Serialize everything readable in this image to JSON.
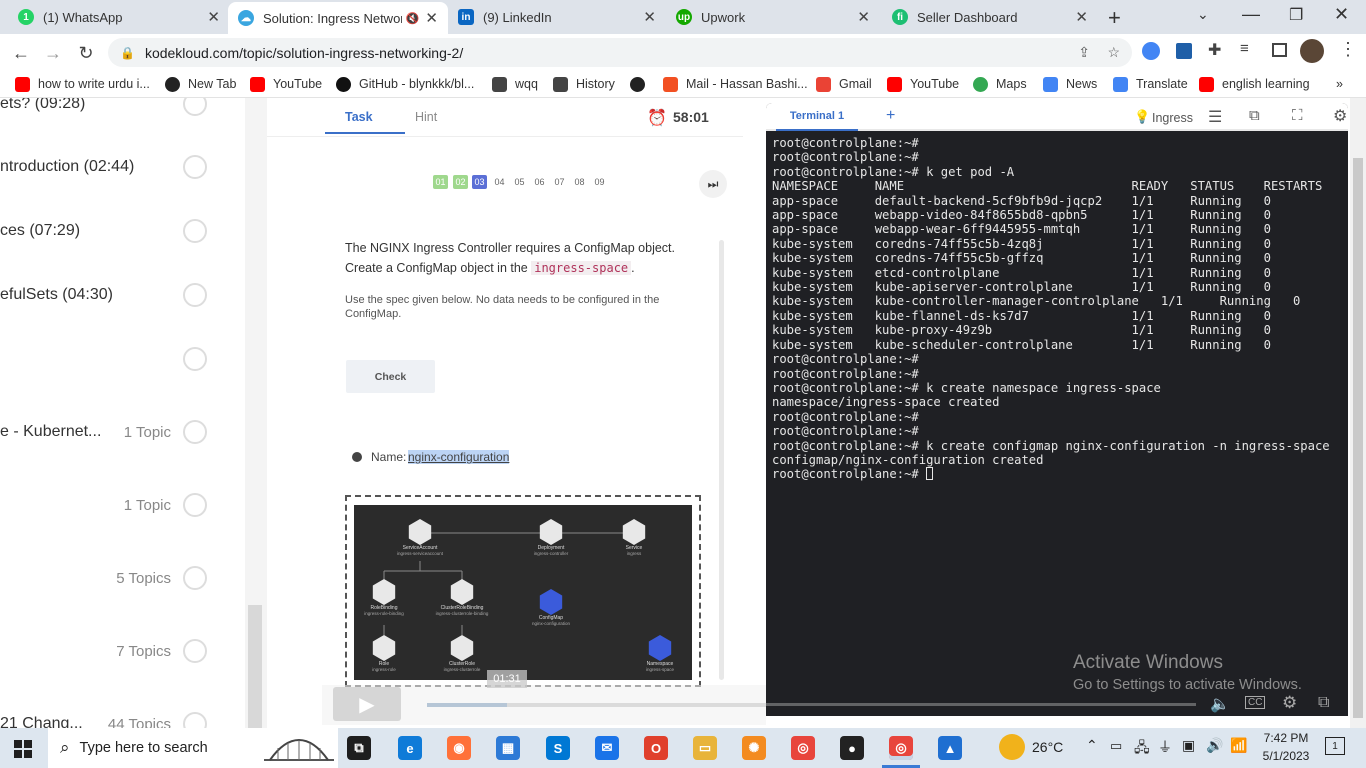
{
  "browser": {
    "tabs": [
      {
        "title": "(1) WhatsApp",
        "icon": "whatsapp-icon",
        "color": "#25d366",
        "glyph": "1"
      },
      {
        "title": "Solution: Ingress Networ",
        "icon": "kodekloud-icon",
        "color": "#3aa6e0",
        "glyph": "☁",
        "audio": "🔇"
      },
      {
        "title": "(9) LinkedIn",
        "icon": "linkedin-icon",
        "color": "#0a66c2",
        "glyph": "in"
      },
      {
        "title": "Upwork",
        "icon": "upwork-icon",
        "color": "#14a800",
        "glyph": "up"
      },
      {
        "title": "Seller Dashboard",
        "icon": "fiverr-icon",
        "color": "#1dbf73",
        "glyph": "fi"
      }
    ],
    "new_tab": "+",
    "url": "kodekloud.com/topic/solution-ingress-networking-2/",
    "bookmarks": [
      {
        "label": "how to write urdu i...",
        "icon": "youtube-icon",
        "color": "#ff0000"
      },
      {
        "label": "New Tab",
        "icon": "globe-icon",
        "color": "#222222"
      },
      {
        "label": "YouTube",
        "icon": "youtube-icon",
        "color": "#ff0000"
      },
      {
        "label": "GitHub - blynkkk/bl...",
        "icon": "github-icon",
        "color": "#111111"
      },
      {
        "label": "wqq",
        "icon": "download-icon",
        "color": "#444444"
      },
      {
        "label": "History",
        "icon": "history-icon",
        "color": "#444444"
      },
      {
        "label": "",
        "icon": "globe-icon",
        "color": "#222222"
      },
      {
        "label": "Mail - Hassan Bashi...",
        "icon": "microsoft-icon",
        "color": "#f25022"
      },
      {
        "label": "Gmail",
        "icon": "gmail-icon",
        "color": "#ea4335"
      },
      {
        "label": "YouTube",
        "icon": "youtube-icon",
        "color": "#ff0000"
      },
      {
        "label": "Maps",
        "icon": "maps-icon",
        "color": "#34a853"
      },
      {
        "label": "News",
        "icon": "news-icon",
        "color": "#4285f4"
      },
      {
        "label": "Translate",
        "icon": "translate-icon",
        "color": "#4285f4"
      },
      {
        "label": "english learning",
        "icon": "youtube-icon",
        "color": "#ff0000"
      }
    ]
  },
  "sidebar": {
    "items": [
      {
        "title": "ets? (09:28)",
        "topics": ""
      },
      {
        "title": "ntroduction (02:44)",
        "topics": ""
      },
      {
        "title": "ces (07:29)",
        "topics": ""
      },
      {
        "title": "efulSets (04:30)",
        "topics": ""
      },
      {
        "title": "",
        "topics": ""
      },
      {
        "title": "e - Kubernet...",
        "topics": "1 Topic"
      },
      {
        "title": "",
        "topics": "1 Topic"
      },
      {
        "title": "",
        "topics": "5 Topics"
      },
      {
        "title": "",
        "topics": "7 Topics"
      },
      {
        "title": "21 Chang...",
        "topics": "44 Topics"
      }
    ]
  },
  "task": {
    "tab_task": "Task",
    "tab_hint": "Hint",
    "timer": "58:01",
    "steps": [
      "01",
      "02",
      "03",
      "04",
      "05",
      "06",
      "07",
      "08",
      "09"
    ],
    "current_step": 3,
    "question_line1": "The NGINX Ingress Controller requires a ConfigMap object.",
    "question_line2_pre": "Create a ConfigMap object in the",
    "question_namespace": "ingress-space",
    "question_line2_post": ".",
    "note": "Use the spec given below. No data needs to be configured in the ConfigMap.",
    "check_button": "Check",
    "name_label": "Name:",
    "name_value": "nginx-configuration",
    "diagram": {
      "nodes": [
        {
          "title": "ServiceAccount",
          "sub": "ingress-serviceaccount"
        },
        {
          "title": "Deployment",
          "sub": "ingress-controller"
        },
        {
          "title": "Service",
          "sub": "ingress"
        },
        {
          "title": "RoleBinding",
          "sub": "ingress-role-binding"
        },
        {
          "title": "ClusterRoleBinding",
          "sub": "ingress-clusterrole-binding"
        },
        {
          "title": "ConfigMap",
          "sub": "nginx-configuration"
        },
        {
          "title": "Role",
          "sub": "ingress-role"
        },
        {
          "title": "ClusterRole",
          "sub": "ingress-clusterrole"
        },
        {
          "title": "Namespace",
          "sub": "ingress-space"
        }
      ]
    },
    "video_time": "01:31"
  },
  "terminal": {
    "tab": "Terminal 1",
    "add": "+",
    "title": "Ingress",
    "lines": [
      "root@controlplane:~#",
      "root@controlplane:~#",
      "root@controlplane:~# k get pod -A",
      "NAMESPACE     NAME                               READY   STATUS    RESTARTS",
      "app-space     default-backend-5cf9bfb9d-jqcp2    1/1     Running   0",
      "app-space     webapp-video-84f8655bd8-qpbn5      1/1     Running   0",
      "app-space     webapp-wear-6ff9445955-mmtqh       1/1     Running   0",
      "kube-system   coredns-74ff55c5b-4zq8j            1/1     Running   0",
      "kube-system   coredns-74ff55c5b-gffzq            1/1     Running   0",
      "kube-system   etcd-controlplane                  1/1     Running   0",
      "kube-system   kube-apiserver-controlplane        1/1     Running   0",
      "kube-system   kube-controller-manager-controlplane   1/1     Running   0",
      "kube-system   kube-flannel-ds-ks7d7              1/1     Running   0",
      "kube-system   kube-proxy-49z9b                   1/1     Running   0",
      "kube-system   kube-scheduler-controlplane        1/1     Running   0",
      "root@controlplane:~#",
      "root@controlplane:~#",
      "root@controlplane:~# k create namespace ingress-space",
      "namespace/ingress-space created",
      "root@controlplane:~#",
      "root@controlplane:~#",
      "root@controlplane:~# k create configmap nginx-configuration -n ingress-space",
      "configmap/nginx-configuration created"
    ],
    "prompt": "root@controlplane:~# "
  },
  "watermark": {
    "line1": "Activate Windows",
    "line2": "Go to Settings to activate Windows."
  },
  "taskbar": {
    "search_placeholder": "Type here to search",
    "temperature": "26°C",
    "time": "7:42 PM",
    "date": "5/1/2023",
    "apps": [
      {
        "icon": "task-view-icon",
        "color": "#1e1e1e",
        "glyph": "⧉"
      },
      {
        "icon": "edge-icon",
        "color": "#0f7bd8",
        "glyph": "e"
      },
      {
        "icon": "firefox-icon",
        "color": "#ff7139",
        "glyph": "◉"
      },
      {
        "icon": "store-icon",
        "color": "#2d7ad6",
        "glyph": "▦"
      },
      {
        "icon": "skype-icon",
        "color": "#0078d4",
        "glyph": "S"
      },
      {
        "icon": "mail-icon",
        "color": "#1a73e8",
        "glyph": "✉"
      },
      {
        "icon": "opera-icon",
        "color": "#e0402c",
        "glyph": "O"
      },
      {
        "icon": "file-explorer-icon",
        "color": "#e8b43a",
        "glyph": "▭"
      },
      {
        "icon": "settings-app-icon",
        "color": "#f38b20",
        "glyph": "✺"
      },
      {
        "icon": "chrome-icon",
        "color": "#e8453c",
        "glyph": "◎"
      },
      {
        "icon": "obs-icon",
        "color": "#222222",
        "glyph": "●"
      },
      {
        "icon": "chrome-profile-icon",
        "color": "#e8453c",
        "glyph": "◎"
      },
      {
        "icon": "photos-icon",
        "color": "#1f6fd1",
        "glyph": "▲"
      }
    ]
  }
}
